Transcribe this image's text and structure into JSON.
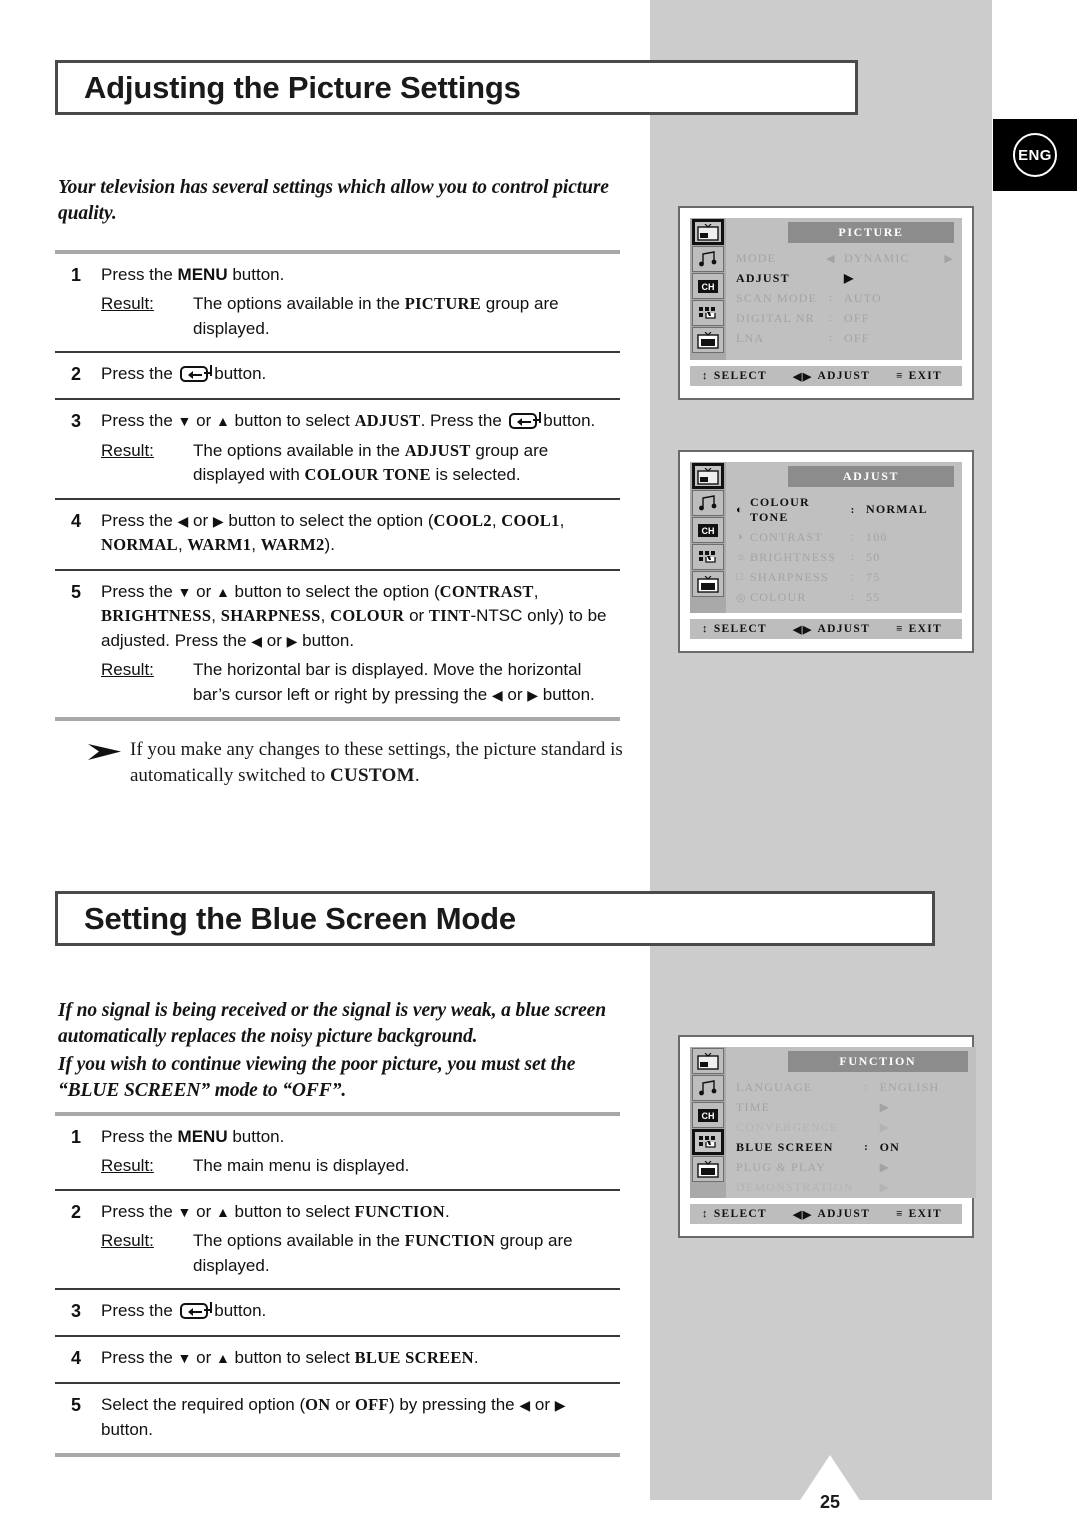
{
  "page": {
    "number": "25",
    "language_badge": "ENG"
  },
  "sections": [
    {
      "title": "Adjusting the Picture Settings",
      "intro": [
        "Your television has several settings which allow you to control picture quality."
      ],
      "steps": [
        {
          "num": "1",
          "line": "Press the MENU button.",
          "result_label": "Result:",
          "result": "The options available in the PICTURE group are displayed."
        },
        {
          "num": "2",
          "line": "Press the ↵ button."
        },
        {
          "num": "3",
          "line": "Press the ▼ or ▲ button to select ADJUST. Press the ↵ button.",
          "result_label": "Result:",
          "result": "The options available in the ADJUST group are displayed with COLOUR TONE is selected."
        },
        {
          "num": "4",
          "line": "Press the ◀ or ▶ button to select the option (COOL2, COOL1, NORMAL, WARM1, WARM2)."
        },
        {
          "num": "5",
          "line": "Press the ▼ or ▲ button to select the option (CONTRAST, BRIGHTNESS, SHARPNESS, COLOUR or TINT-NTSC only) to be adjusted. Press the ◀ or ▶ button.",
          "result_label": "Result:",
          "result": "The horizontal bar is displayed. Move the horizontal bar's cursor left or right by pressing the ◀ or ▶ button."
        }
      ],
      "note": "If you make any changes to these settings, the picture standard is automatically switched to CUSTOM."
    },
    {
      "title": "Setting the Blue Screen Mode",
      "intro": [
        "If no signal is being received or the signal is very weak, a blue screen automatically replaces the noisy picture background.",
        "If you wish to continue viewing the poor picture, you must set the “BLUE SCREEN” mode to “OFF”."
      ],
      "steps": [
        {
          "num": "1",
          "line": "Press the MENU button.",
          "result_label": "Result:",
          "result": "The main menu is displayed."
        },
        {
          "num": "2",
          "line": "Press the ▼ or ▲ button to select FUNCTION.",
          "result_label": "Result:",
          "result": "The options available in the FUNCTION group are displayed."
        },
        {
          "num": "3",
          "line": "Press the ↵ button."
        },
        {
          "num": "4",
          "line": "Press the ▼ or ▲ button to select BLUE SCREEN."
        },
        {
          "num": "5",
          "line": "Select the required option (ON or OFF) by pressing the ◀ or ▶ button."
        }
      ]
    }
  ],
  "osd_menus": [
    {
      "id": "picture",
      "title": "PICTURE",
      "active_rail": 0,
      "rows": [
        {
          "label": "MODE",
          "mid": "◀",
          "value": "DYNAMIC",
          "right": "▶",
          "state": "dim"
        },
        {
          "label": "ADJUST",
          "mid": "",
          "value": "▶",
          "right": "",
          "state": "sel"
        },
        {
          "label": "SCAN MODE",
          "mid": ":",
          "value": "AUTO",
          "right": "",
          "state": "dim"
        },
        {
          "label": "DIGITAL NR",
          "mid": ":",
          "value": "OFF",
          "right": "",
          "state": "dim"
        },
        {
          "label": "LNA",
          "mid": ":",
          "value": "OFF",
          "right": "",
          "state": "dim"
        }
      ],
      "footer": [
        {
          "glyph": "↕",
          "label": "SELECT"
        },
        {
          "glyph": "◀▶",
          "label": "ADJUST"
        },
        {
          "glyph": "≡",
          "label": "EXIT"
        }
      ]
    },
    {
      "id": "adjust",
      "title": "ADJUST",
      "active_rail": 0,
      "rows": [
        {
          "icon": "◐",
          "label": "COLOUR TONE",
          "mid": ":",
          "value": "NORMAL",
          "state": "sel"
        },
        {
          "icon": "◑",
          "label": "CONTRAST",
          "mid": ":",
          "value": "100",
          "state": "dim"
        },
        {
          "icon": "☼",
          "label": "BRIGHTNESS",
          "mid": ":",
          "value": "50",
          "state": "dim"
        },
        {
          "icon": "□",
          "label": "SHARPNESS",
          "mid": ":",
          "value": "75",
          "state": "dim"
        },
        {
          "icon": "◎",
          "label": "COLOUR",
          "mid": ":",
          "value": "55",
          "state": "dim"
        }
      ],
      "footer": [
        {
          "glyph": "↕",
          "label": "SELECT"
        },
        {
          "glyph": "◀▶",
          "label": "ADJUST"
        },
        {
          "glyph": "≡",
          "label": "EXIT"
        }
      ]
    },
    {
      "id": "function",
      "title": "FUNCTION",
      "active_rail": 3,
      "rows": [
        {
          "label": "LANGUAGE",
          "mid": ":",
          "value": "ENGLISH",
          "state": "dim"
        },
        {
          "label": "TIME",
          "mid": "",
          "value": "▶",
          "state": "dim"
        },
        {
          "label": "CONVERGENCE",
          "mid": "",
          "value": "▶",
          "state": "dimmer"
        },
        {
          "label": "BLUE SCREEN",
          "mid": ":",
          "value": "ON",
          "state": "sel"
        },
        {
          "label": "PLUG & PLAY",
          "mid": "",
          "value": "▶",
          "state": "dim"
        },
        {
          "label": "DEMONSTRATION",
          "mid": "",
          "value": "▶",
          "state": "dimmer"
        }
      ],
      "footer": [
        {
          "glyph": "↕",
          "label": "SELECT"
        },
        {
          "glyph": "◀▶",
          "label": "ADJUST"
        },
        {
          "glyph": "≡",
          "label": "EXIT"
        }
      ]
    }
  ],
  "colors": {
    "band": "#cccccc",
    "osd_bg": "#c0c0c0",
    "osd_title_bg": "#8c8c8c",
    "rule": "#3a3a3a"
  }
}
